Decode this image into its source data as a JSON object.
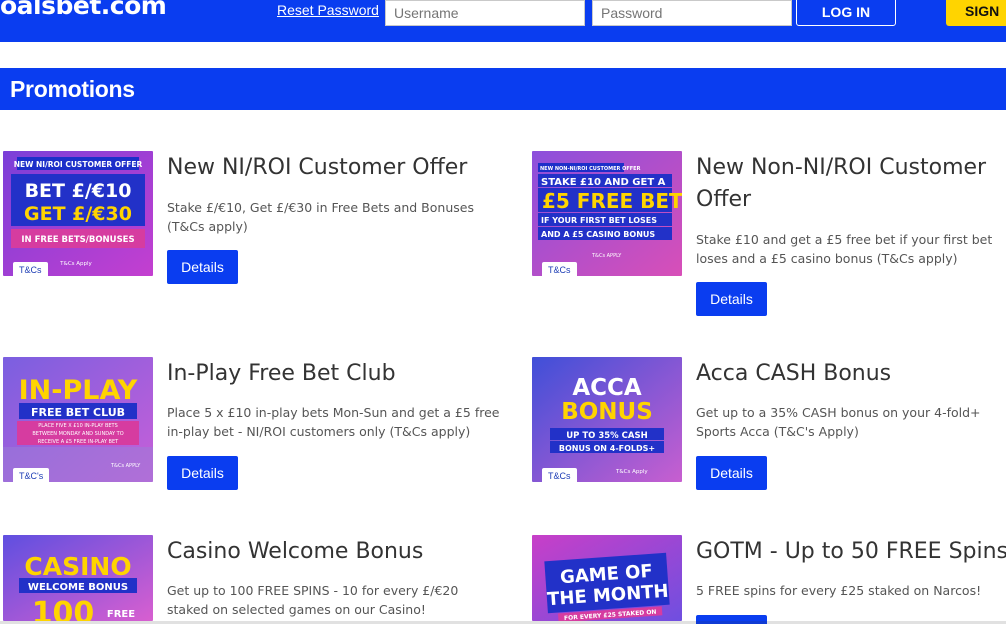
{
  "header": {
    "logo_text": "oalsbet.com",
    "reset_password": "Reset Password",
    "username_placeholder": "Username",
    "password_placeholder": "Password",
    "login_label": "LOG IN",
    "signup_label": "SIGN",
    "brand_color": "#0a3df0",
    "accent_color": "#ffd400"
  },
  "section": {
    "title": "Promotions"
  },
  "promos": [
    {
      "title": "New NI/ROI Customer Offer",
      "description": "Stake £/€10, Get £/€30 in Free Bets and Bonuses (T&Cs apply)",
      "details_label": "Details",
      "tc_label": "T&Cs",
      "banner": {
        "top": "NEW NI/ROI CUSTOMER OFFER",
        "line1": "BET £/€10",
        "line2": "GET £/€30",
        "line3": "IN FREE BETS/BONUSES",
        "small": "T&Cs Apply"
      }
    },
    {
      "title": "New Non-NI/ROI Customer Offer",
      "description": "Stake £10 and get a £5 free bet if your first bet loses and a £5 casino bonus (T&Cs apply)",
      "details_label": "Details",
      "tc_label": "T&Cs",
      "banner": {
        "top": "NEW NON-NI/ROI CUSTOMER OFFER",
        "line1": "STAKE £10 AND GET A",
        "line2": "£5 FREE BET",
        "line3": "IF YOUR FIRST BET LOSES",
        "line4": "AND A £5 CASINO BONUS",
        "small": "T&Cs APPLY"
      }
    },
    {
      "title": "In-Play Free Bet Club",
      "description": "Place 5 x £10 in-play bets Mon-Sun and get a £5 free in-play bet - NI/ROI customers only (T&Cs apply)",
      "details_label": "Details",
      "tc_label": "T&C's",
      "banner": {
        "line1": "IN-PLAY",
        "line2": "FREE BET CLUB",
        "line3": "PLACE FIVE X £10 IN-PLAY BETS",
        "line4": "BETWEEN MONDAY AND SUNDAY TO",
        "line5": "RECEIVE A £5 FREE IN-PLAY BET",
        "small": "T&Cs APPLY"
      }
    },
    {
      "title": "Acca CASH Bonus",
      "description": "Get up to a 35% CASH bonus on your 4-fold+ Sports Acca (T&C's Apply)",
      "details_label": "Details",
      "tc_label": "T&Cs",
      "banner": {
        "line1": "ACCA",
        "line2": "BONUS",
        "line3": "UP TO 35% CASH",
        "line4": "BONUS ON 4-FOLDS+",
        "small": "T&Cs Apply"
      }
    },
    {
      "title": "Casino Welcome Bonus",
      "description": "Get up to 100 FREE SPINS - 10 for every £/€20 staked on selected games on our Casino!",
      "banner": {
        "line1": "CASINO",
        "line2": "WELCOME BONUS",
        "line3": "100",
        "line4": "FREE"
      }
    },
    {
      "title": "GOTM - Up to 50 FREE Spins",
      "description": "5 FREE spins for every £25 staked on Narcos!",
      "banner": {
        "line1": "GAME OF",
        "line2": "THE MONTH",
        "line3": "FOR EVERY £25 STAKED ON"
      }
    }
  ]
}
